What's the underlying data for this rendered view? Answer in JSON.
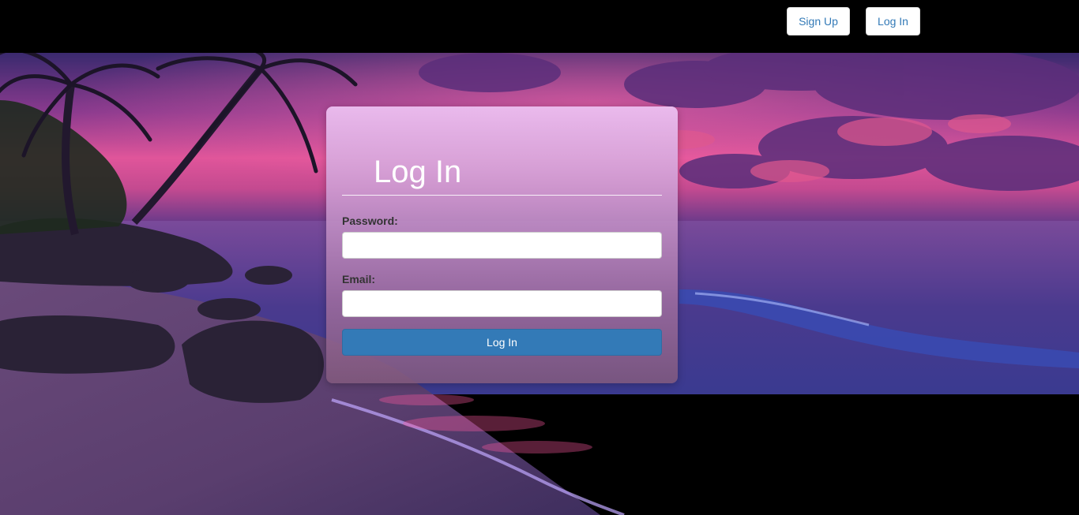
{
  "nav": {
    "signup_label": "Sign Up",
    "login_label": "Log In"
  },
  "login_card": {
    "title": "Log In",
    "password_label": "Password:",
    "password_value": "",
    "email_label": "Email:",
    "email_value": "",
    "submit_label": "Log In"
  },
  "colors": {
    "accent": "#337ab7",
    "topbar": "#000000"
  }
}
